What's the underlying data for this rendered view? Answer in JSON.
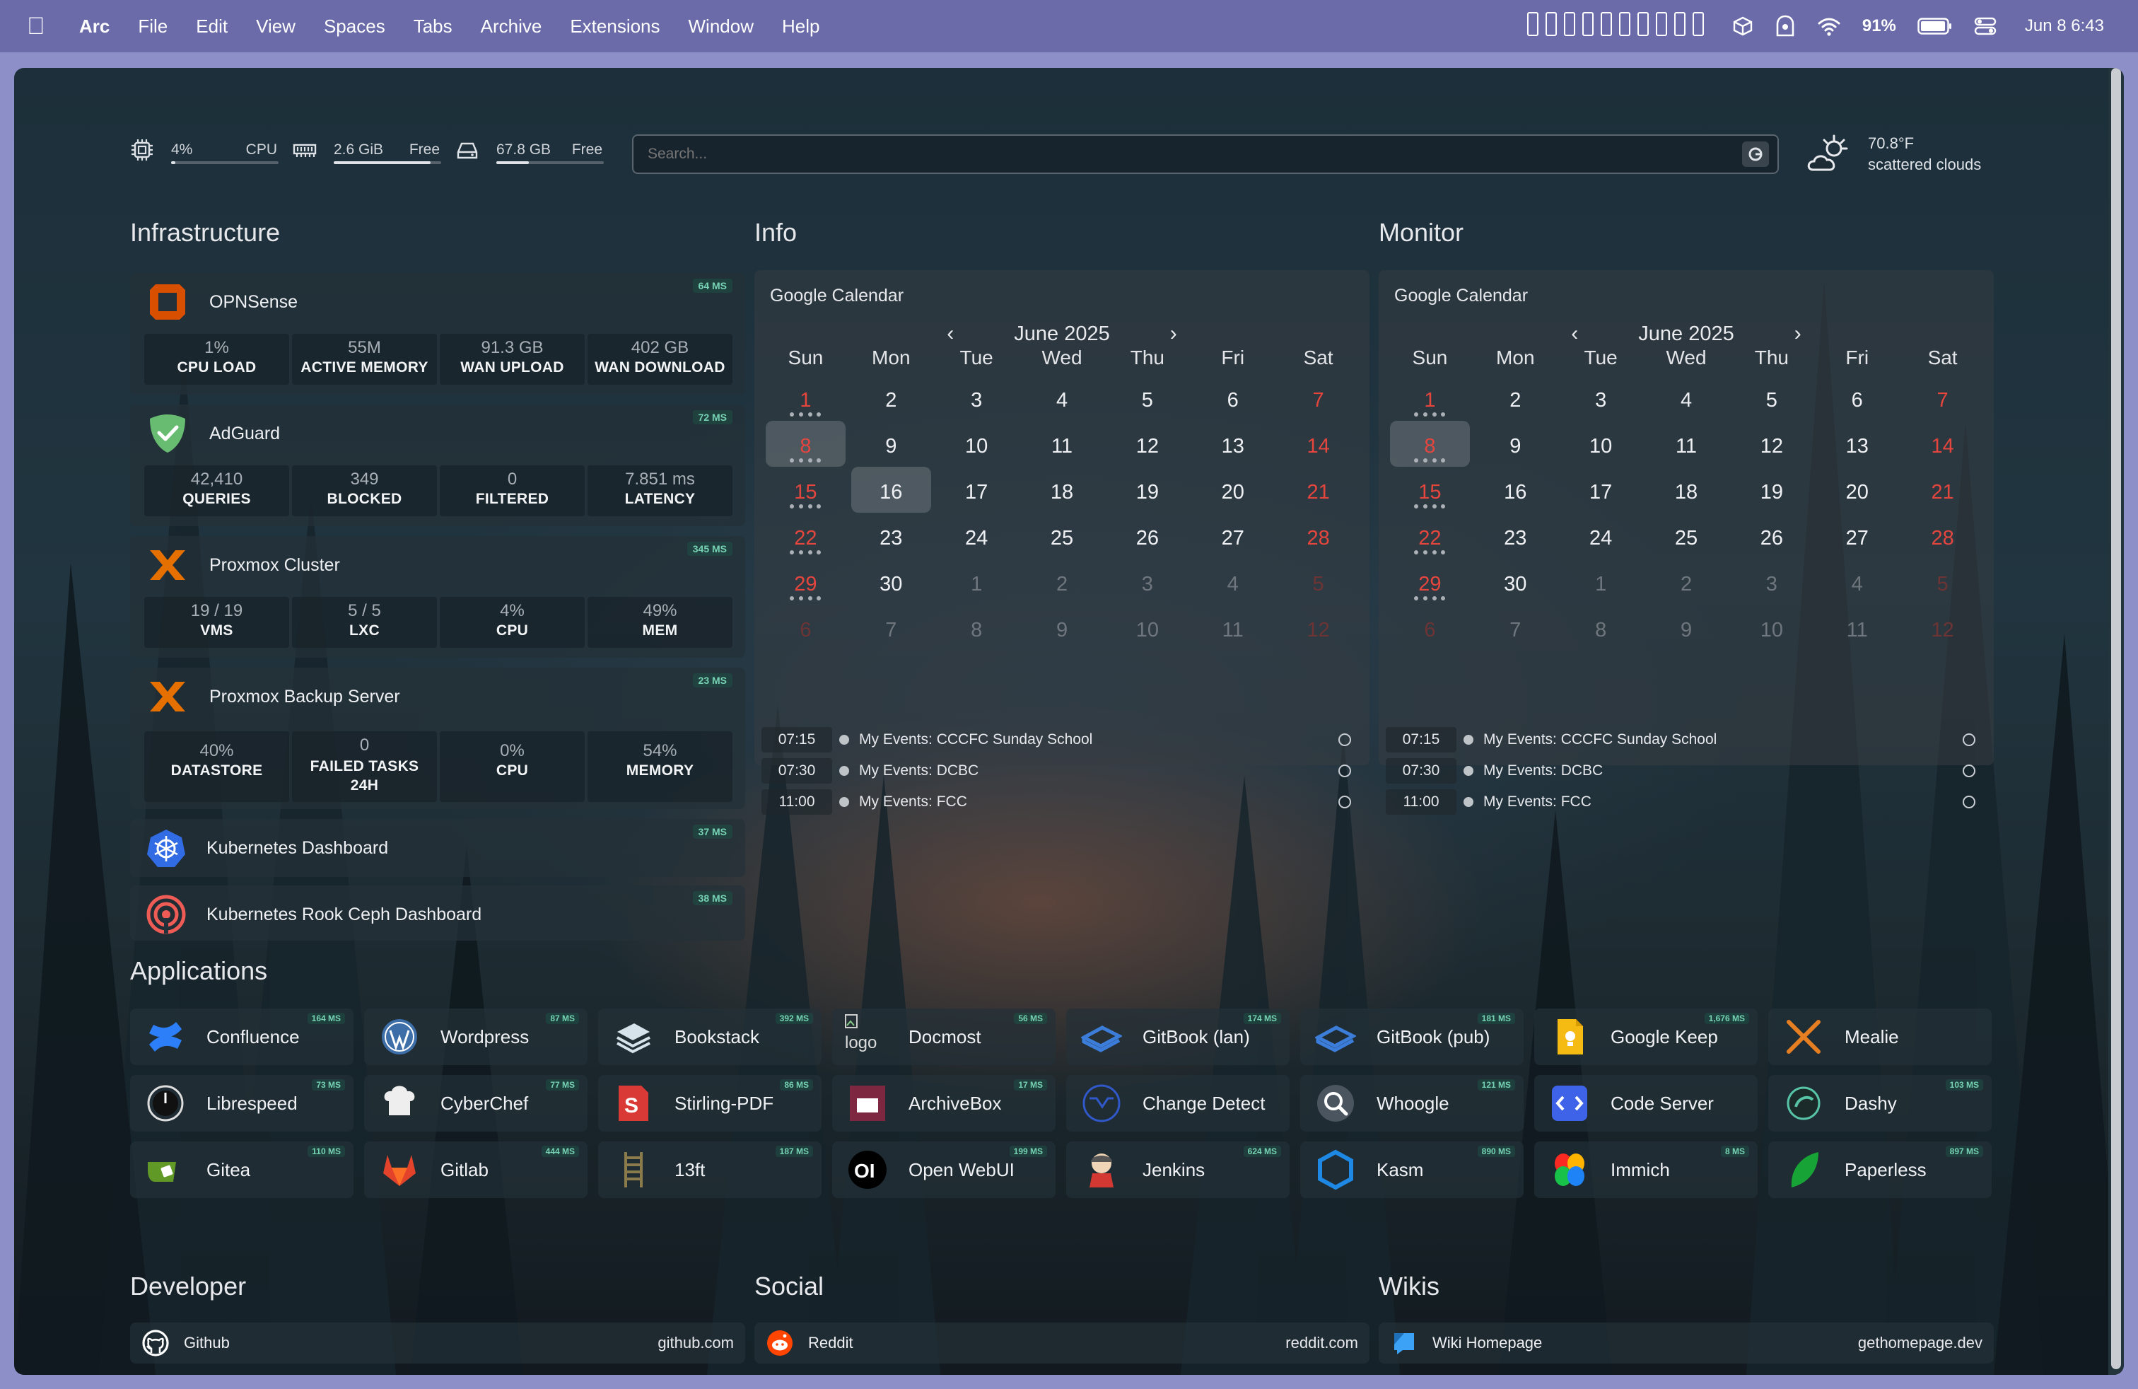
{
  "menubar": {
    "app": "Arc",
    "items": [
      "File",
      "Edit",
      "View",
      "Spaces",
      "Tabs",
      "Archive",
      "Extensions",
      "Window",
      "Help"
    ],
    "battery": "91%",
    "datetime": "Jun 8  6:43"
  },
  "resources": {
    "cpu": {
      "value": "4%",
      "label": "CPU",
      "usage": 0.04
    },
    "memory": {
      "value": "2.6 GiB",
      "label": "Free",
      "usage": 0.9
    },
    "disk": {
      "value": "67.8 GB",
      "label": "Free",
      "usage": 0.3
    }
  },
  "search": {
    "placeholder": "Search..."
  },
  "weather": {
    "temp": "70.8°F",
    "desc": "scattered clouds"
  },
  "sections": {
    "infrastructure": "Infrastructure",
    "info": "Info",
    "monitor": "Monitor",
    "applications": "Applications",
    "developer": "Developer",
    "social": "Social",
    "wikis": "Wikis"
  },
  "infra": [
    {
      "name": "OPNSense",
      "ms": "64 MS",
      "icon": "opnsense-icon",
      "stats": [
        {
          "v": "1%",
          "l": "CPU LOAD"
        },
        {
          "v": "55M",
          "l": "ACTIVE MEMORY"
        },
        {
          "v": "91.3 GB",
          "l": "WAN UPLOAD"
        },
        {
          "v": "402 GB",
          "l": "WAN DOWNLOAD"
        }
      ]
    },
    {
      "name": "AdGuard",
      "ms": "72 MS",
      "icon": "adguard-icon",
      "stats": [
        {
          "v": "42,410",
          "l": "QUERIES"
        },
        {
          "v": "349",
          "l": "BLOCKED"
        },
        {
          "v": "0",
          "l": "FILTERED"
        },
        {
          "v": "7.851 ms",
          "l": "LATENCY"
        }
      ]
    },
    {
      "name": "Proxmox Cluster",
      "ms": "345 MS",
      "icon": "proxmox-icon",
      "stats": [
        {
          "v": "19 / 19",
          "l": "VMS"
        },
        {
          "v": "5 / 5",
          "l": "LXC"
        },
        {
          "v": "4%",
          "l": "CPU"
        },
        {
          "v": "49%",
          "l": "MEM"
        }
      ]
    },
    {
      "name": "Proxmox Backup Server",
      "ms": "23 MS",
      "icon": "proxmox-icon",
      "stats": [
        {
          "v": "40%",
          "l": "DATASTORE"
        },
        {
          "v": "0",
          "l": "FAILED TASKS 24H"
        },
        {
          "v": "0%",
          "l": "CPU"
        },
        {
          "v": "54%",
          "l": "MEMORY"
        }
      ]
    },
    {
      "name": "Kubernetes Dashboard",
      "ms": "37 MS",
      "icon": "kubernetes-icon"
    },
    {
      "name": "Kubernetes Rook Ceph Dashboard",
      "ms": "38 MS",
      "icon": "ceph-icon"
    }
  ],
  "calendar": {
    "title": "Google Calendar",
    "month": "June 2025",
    "prev": "‹",
    "next": "›",
    "weekdays": [
      "Sun",
      "Mon",
      "Tue",
      "Wed",
      "Thu",
      "Fri",
      "Sat"
    ],
    "days": [
      "1",
      "2",
      "3",
      "4",
      "5",
      "6",
      "7",
      "8",
      "9",
      "10",
      "11",
      "12",
      "13",
      "14",
      "15",
      "16",
      "17",
      "18",
      "19",
      "20",
      "21",
      "22",
      "23",
      "24",
      "25",
      "26",
      "27",
      "28",
      "29",
      "30",
      "1",
      "2",
      "3",
      "4",
      "5",
      "6",
      "7",
      "8",
      "9",
      "10",
      "11",
      "12"
    ],
    "events": [
      {
        "time": "07:15",
        "title": "My Events: CCCFC Sunday School"
      },
      {
        "time": "07:30",
        "title": "My Events: DCBC"
      },
      {
        "time": "11:00",
        "title": "My Events: FCC"
      }
    ]
  },
  "apps": [
    {
      "name": "Confluence",
      "ms": "164 MS",
      "icon": "confluence-icon",
      "color": "#2d7ff9"
    },
    {
      "name": "Wordpress",
      "ms": "87 MS",
      "icon": "wordpress-icon",
      "color": "#3d6ea8"
    },
    {
      "name": "Bookstack",
      "ms": "392 MS",
      "icon": "bookstack-icon",
      "color": "#d7e3ea"
    },
    {
      "name": "Docmost",
      "ms": "56 MS",
      "icon": "broken-image-icon",
      "color": "#dddddd",
      "alt": "logo"
    },
    {
      "name": "GitBook (lan)",
      "ms": "174 MS",
      "icon": "gitbook-icon",
      "color": "#3b7dd8"
    },
    {
      "name": "GitBook (pub)",
      "ms": "181 MS",
      "icon": "gitbook-icon",
      "color": "#3b7dd8"
    },
    {
      "name": "Google Keep",
      "ms": "1,676 MS",
      "icon": "google-keep-icon",
      "color": "#f6bb12"
    },
    {
      "name": "Mealie",
      "ms": "",
      "icon": "mealie-icon",
      "color": "#e67e22"
    },
    {
      "name": "Librespeed",
      "ms": "73 MS",
      "icon": "librespeed-icon",
      "color": "#dddddd"
    },
    {
      "name": "CyberChef",
      "ms": "77 MS",
      "icon": "cyberchef-icon",
      "color": "#eeeeee"
    },
    {
      "name": "Stirling-PDF",
      "ms": "86 MS",
      "icon": "stirling-pdf-icon",
      "color": "#d93a35"
    },
    {
      "name": "ArchiveBox",
      "ms": "17 MS",
      "icon": "archivebox-icon",
      "color": "#7d2740"
    },
    {
      "name": "Change Detect",
      "ms": "",
      "icon": "change-detect-icon",
      "color": "#3058c9"
    },
    {
      "name": "Whoogle",
      "ms": "121 MS",
      "icon": "whoogle-icon",
      "color": "#dddddd"
    },
    {
      "name": "Code Server",
      "ms": "",
      "icon": "code-server-icon",
      "color": "#3f63e8"
    },
    {
      "name": "Dashy",
      "ms": "103 MS",
      "icon": "dashy-icon",
      "color": "#57c4a7"
    },
    {
      "name": "Gitea",
      "ms": "110 MS",
      "icon": "gitea-icon",
      "color": "#609926"
    },
    {
      "name": "Gitlab",
      "ms": "444 MS",
      "icon": "gitlab-icon",
      "color": "#e2432a"
    },
    {
      "name": "13ft",
      "ms": "187 MS",
      "icon": "ladder-icon",
      "color": "#8b7b4a"
    },
    {
      "name": "Open WebUI",
      "ms": "199 MS",
      "icon": "open-webui-icon",
      "color": "#000000"
    },
    {
      "name": "Jenkins",
      "ms": "624 MS",
      "icon": "jenkins-icon",
      "color": "#d33833"
    },
    {
      "name": "Kasm",
      "ms": "890 MS",
      "icon": "kasm-icon",
      "color": "#1e88e5"
    },
    {
      "name": "Immich",
      "ms": "8 MS",
      "icon": "immich-icon",
      "color": "#fa2921"
    },
    {
      "name": "Paperless",
      "ms": "897 MS",
      "icon": "paperless-icon",
      "color": "#17541f"
    }
  ],
  "bookmarks": [
    {
      "name": "Github",
      "url": "github.com",
      "icon": "github-icon"
    },
    {
      "name": "Reddit",
      "url": "reddit.com",
      "icon": "reddit-icon"
    },
    {
      "name": "Wiki Homepage",
      "url": "gethomepage.dev",
      "icon": "wiki-icon"
    }
  ]
}
